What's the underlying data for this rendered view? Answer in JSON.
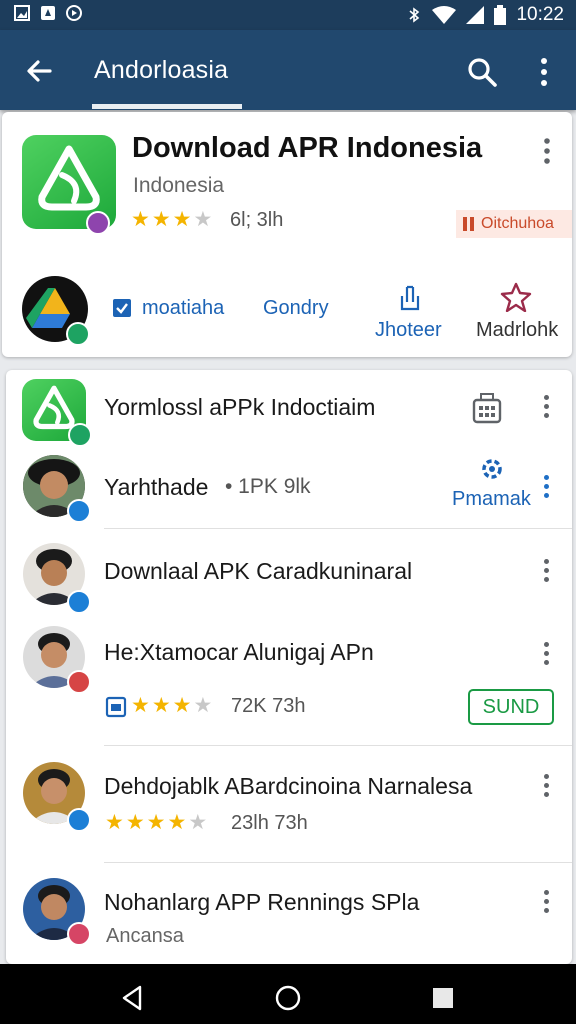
{
  "status_bar": {
    "time": "10:22",
    "icons": [
      "image-icon",
      "android-icon",
      "circle-record-icon",
      "bluetooth-icon",
      "wifi-icon",
      "signal-icon",
      "battery-icon"
    ]
  },
  "app_bar": {
    "title": "Andorloasia",
    "icons": [
      "back-arrow-icon",
      "search-icon",
      "more-vert-icon"
    ]
  },
  "featured": {
    "title": "Download APR Indonesia",
    "subtitle": "Indonesia",
    "rating": 3,
    "meta": "6l; 3lh",
    "badge": "Oitchuhoa",
    "actions": [
      {
        "label": "moatiaha",
        "icon": "checkbox-icon"
      },
      {
        "label": "Gondry",
        "icon": ""
      },
      {
        "label": "Jhoteer",
        "icon": "share-icon"
      },
      {
        "label": "Madrlohk",
        "icon": "star-outline-icon"
      }
    ]
  },
  "list": [
    {
      "title": "Yormlossl aPPk Indoctiaim",
      "meta": "",
      "right_icon": "calendar-grid-icon"
    },
    {
      "title": "Yarhthade",
      "meta": "• 1PK 9lk",
      "right_label": "Pmamak",
      "right_icon": "settings-icon"
    },
    {
      "title": "Downlaal APK Caradkuninaral"
    },
    {
      "title": "He:Xtamocar Alunigaj APn",
      "rating": 3,
      "meta": "72K 73h",
      "button": "SUND"
    },
    {
      "title": "Dehdojablk ABardcinoina Narnalesa",
      "rating": 4,
      "meta": "23lh 73h"
    },
    {
      "title": "Nohanlarg APP Rennings SPla",
      "subtitle": "Ancansa"
    }
  ],
  "nav": {
    "icons": [
      "back-triangle-icon",
      "home-circle-icon",
      "recents-square-icon"
    ]
  },
  "colors": {
    "appbar": "#21486e",
    "statusbar": "#1d3d5c",
    "accent": "#1c63b5",
    "star": "#f4b400",
    "green": "#1a9a44"
  }
}
